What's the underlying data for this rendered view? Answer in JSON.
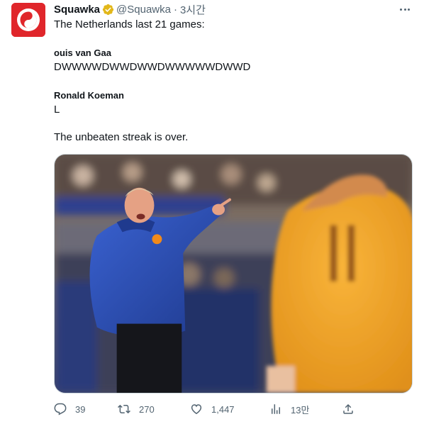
{
  "tweet": {
    "author_name": "Squawka",
    "author_handle": "@Squawka",
    "separator": "·",
    "time": "3시간",
    "lines": [
      "The Netherlands last 21 games:",
      "ouis van Gaa",
      "DWWWWDWWDWWDWWWWWDWWD",
      "Ronald Koeman",
      "L",
      "The unbeaten streak is over."
    ]
  },
  "icons": {
    "avatar": "squawka-logo",
    "verified": "verified-gold-badge-icon",
    "more": "more-horizontal-icon",
    "reply": "reply-icon",
    "retweet": "retweet-icon",
    "like": "like-heart-icon",
    "views": "views-chart-icon",
    "share": "share-icon"
  },
  "actions": {
    "replies": "39",
    "retweets": "270",
    "likes": "1,447",
    "views": "13만"
  },
  "colors": {
    "text": "#0f1419",
    "muted": "#536471",
    "brand": "#e0262b",
    "verified_gold": "#e2b719",
    "jacket_blue": "#2b4fb8",
    "jersey_orange": "#f5a623"
  }
}
